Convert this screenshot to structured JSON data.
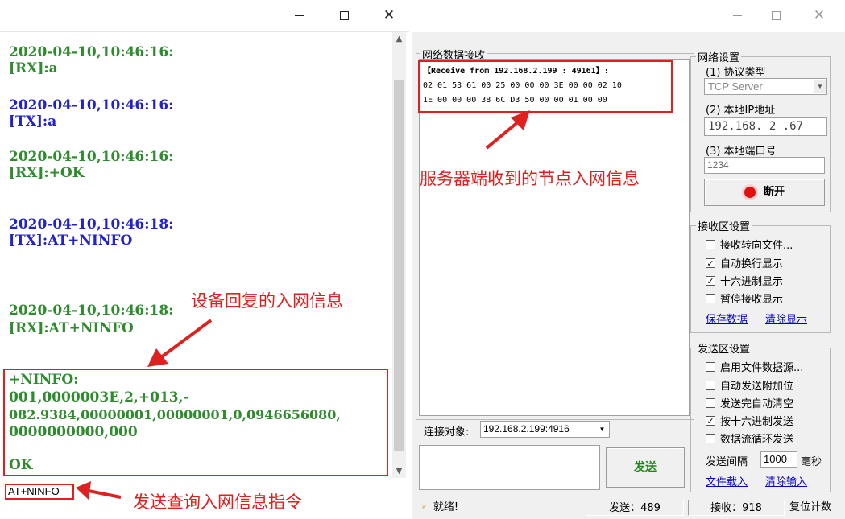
{
  "left_window": {
    "title_buttons": {
      "minimize": "—",
      "maximize": "☐",
      "close": "✕"
    },
    "log": [
      {
        "text": "2020-04-10,10:46:16:",
        "color": "#2e8b2e"
      },
      {
        "text": "[RX]:a",
        "color": "#2e8b2e"
      },
      {
        "text": "2020-04-10,10:46:16:",
        "color": "#2222cc"
      },
      {
        "text": "[TX]:a",
        "color": "#2222cc"
      },
      {
        "text": "2020-04-10,10:46:16:",
        "color": "#2e8b2e"
      },
      {
        "text": "[RX]:+OK",
        "color": "#2e8b2e"
      },
      {
        "text": "2020-04-10,10:46:18:",
        "color": "#2222cc"
      },
      {
        "text": "[TX]:AT+NINFO",
        "color": "#2222cc"
      },
      {
        "text": "2020-04-10,10:46:18:",
        "color": "#2e8b2e"
      },
      {
        "text": "[RX]:AT+NINFO",
        "color": "#2e8b2e"
      },
      {
        "text": "+NINFO:",
        "color": "#2e8b2e"
      },
      {
        "text": "001,0000003E,2,+013,-",
        "color": "#2e8b2e"
      },
      {
        "text": "082.9384,00000001,00000001,0,0946656080,",
        "color": "#2e8b2e"
      },
      {
        "text": "0000000000,000",
        "color": "#2e8b2e"
      },
      {
        "text": "OK",
        "color": "#2e8b2e"
      }
    ],
    "command_input": "AT+NINFO",
    "annotations": {
      "reply": "设备回复的入网信息",
      "send": "发送查询入网信息指令"
    }
  },
  "right_window": {
    "rx_group_title": "网络数据接收",
    "rx_lines": [
      "【Receive from 192.168.2.199 : 49161】:",
      "02 01 53 61 00 25 00 00 00 3E 00 00 02 10",
      "1E 00 00 00 38 6C D3 50 00 00 01 00 00"
    ],
    "annotation_server": "服务器端收到的节点入网信息",
    "net_settings": {
      "title": "网络设置",
      "protocol_label": "(1) 协议类型",
      "protocol_value": "TCP Server",
      "ip_label": "(2) 本地IP地址",
      "ip_value": "192.168. 2 .67",
      "port_label": "(3) 本地端口号",
      "port_value": "1234",
      "disconnect_button": "断开"
    },
    "rx_settings": {
      "title": "接收区设置",
      "options": [
        {
          "label": "接收转向文件...",
          "checked": false
        },
        {
          "label": "自动换行显示",
          "checked": true
        },
        {
          "label": "十六进制显示",
          "checked": true
        },
        {
          "label": "暂停接收显示",
          "checked": false
        }
      ],
      "save_link": "保存数据",
      "clear_link": "清除显示"
    },
    "tx_settings": {
      "title": "发送区设置",
      "options": [
        {
          "label": "启用文件数据源...",
          "checked": false
        },
        {
          "label": "自动发送附加位",
          "checked": false
        },
        {
          "label": "发送完自动清空",
          "checked": false
        },
        {
          "label": "按十六进制发送",
          "checked": true
        },
        {
          "label": "数据流循环发送",
          "checked": false
        }
      ],
      "interval_label": "发送间隔",
      "interval_value": "1000",
      "interval_unit": "毫秒",
      "load_file_link": "文件载入",
      "clear_input_link": "清除输入"
    },
    "connect_target_label": "连接对象:",
    "connect_target_value": "192.168.2.199:4916",
    "send_button": "发送",
    "status": {
      "ready": "就绪!",
      "sent": "发送：489",
      "received": "接收：918",
      "reset": "复位计数"
    }
  }
}
